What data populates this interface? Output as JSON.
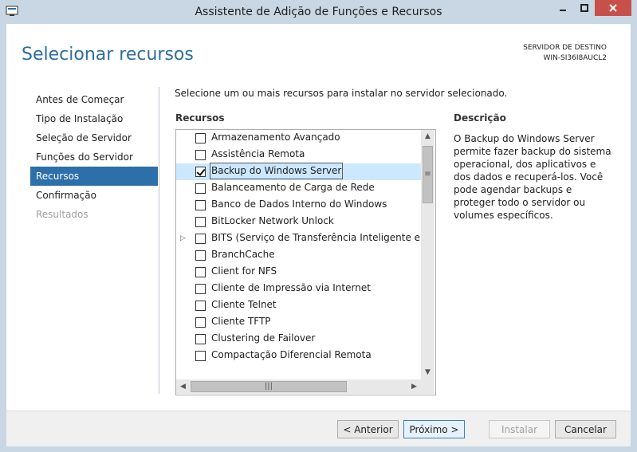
{
  "window": {
    "title": "Assistente de Adição de Funções e Recursos"
  },
  "header": {
    "page_title": "Selecionar recursos",
    "destination_label": "SERVIDOR DE DESTINO",
    "destination_server": "WIN-SI36I8AUCL2"
  },
  "nav": {
    "items": [
      {
        "label": "Antes de Começar",
        "state": "normal"
      },
      {
        "label": "Tipo de Instalação",
        "state": "normal"
      },
      {
        "label": "Seleção de Servidor",
        "state": "normal"
      },
      {
        "label": "Funções do Servidor",
        "state": "normal"
      },
      {
        "label": "Recursos",
        "state": "active"
      },
      {
        "label": "Confirmação",
        "state": "normal"
      },
      {
        "label": "Resultados",
        "state": "disabled"
      }
    ]
  },
  "main": {
    "intro": "Selecione um ou mais recursos para instalar no servidor selecionado.",
    "features_label": "Recursos",
    "description_label": "Descrição",
    "description_text": "O Backup do Windows Server permite fazer backup do sistema operacional, dos aplicativos e dos dados e recuperá-los. Você pode agendar backups e proteger todo o servidor ou volumes específicos."
  },
  "features": [
    {
      "label": "Armazenamento Avançado",
      "checked": false,
      "expandable": false,
      "selected": false
    },
    {
      "label": "Assistência Remota",
      "checked": false,
      "expandable": false,
      "selected": false
    },
    {
      "label": "Backup do Windows Server",
      "checked": true,
      "expandable": false,
      "selected": true
    },
    {
      "label": "Balanceamento de Carga de Rede",
      "checked": false,
      "expandable": false,
      "selected": false
    },
    {
      "label": "Banco de Dados Interno do Windows",
      "checked": false,
      "expandable": false,
      "selected": false
    },
    {
      "label": "BitLocker Network Unlock",
      "checked": false,
      "expandable": false,
      "selected": false
    },
    {
      "label": "BITS (Serviço de Transferência Inteligente em Segu",
      "checked": false,
      "expandable": true,
      "selected": false
    },
    {
      "label": "BranchCache",
      "checked": false,
      "expandable": false,
      "selected": false
    },
    {
      "label": "Client for NFS",
      "checked": false,
      "expandable": false,
      "selected": false
    },
    {
      "label": "Cliente de Impressão via Internet",
      "checked": false,
      "expandable": false,
      "selected": false
    },
    {
      "label": "Cliente Telnet",
      "checked": false,
      "expandable": false,
      "selected": false
    },
    {
      "label": "Cliente TFTP",
      "checked": false,
      "expandable": false,
      "selected": false
    },
    {
      "label": "Clustering de Failover",
      "checked": false,
      "expandable": false,
      "selected": false
    },
    {
      "label": "Compactação Diferencial Remota",
      "checked": false,
      "expandable": false,
      "selected": false
    }
  ],
  "footer": {
    "previous": "< Anterior",
    "next": "Próximo >",
    "install": "Instalar",
    "cancel": "Cancelar"
  },
  "colors": {
    "accent": "#2d6fa8",
    "title_blue": "#2d6f9a",
    "close_red": "#c7504b"
  }
}
